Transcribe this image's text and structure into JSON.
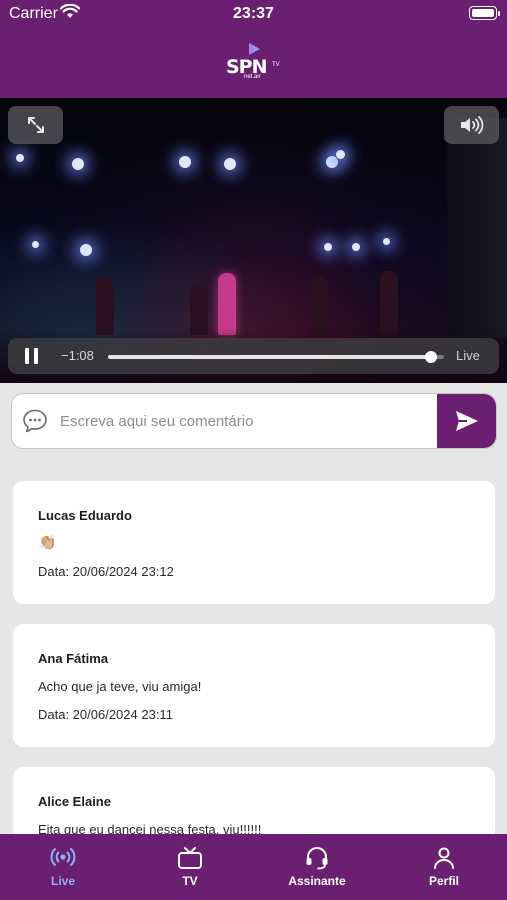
{
  "status_bar": {
    "carrier": "Carrier",
    "time": "23:37"
  },
  "header": {
    "logo_main": "SPN",
    "logo_sub": "net.air",
    "logo_tv": "TV"
  },
  "player": {
    "time_remaining": "−1:08",
    "live_label": "Live",
    "progress": 0.96,
    "icons": [
      "expand-icon",
      "volume-icon",
      "pause-icon"
    ]
  },
  "comment_input": {
    "placeholder": "Escreva aqui seu comentário",
    "value": ""
  },
  "comments": [
    {
      "author": "Lucas Eduardo",
      "text": "👏🏼",
      "date": "Data: 20/06/2024 23:12"
    },
    {
      "author": "Ana Fátima",
      "text": "Acho que ja teve, viu amiga!",
      "date": "Data: 20/06/2024 23:11"
    },
    {
      "author": "Alice Elaine",
      "text": "Eita que eu dancei nessa festa, viu!!!!!!",
      "date": ""
    }
  ],
  "tabs": [
    {
      "label": "Live",
      "icon": "broadcast-icon",
      "active": true
    },
    {
      "label": "TV",
      "icon": "tv-icon",
      "active": false
    },
    {
      "label": "Assinante",
      "icon": "headset-icon",
      "active": false
    },
    {
      "label": "Perfil",
      "icon": "person-icon",
      "active": false
    }
  ],
  "colors": {
    "brand": "#6b1f70",
    "active_tab": "#8fb0ff",
    "background": "#e6e6e6"
  }
}
